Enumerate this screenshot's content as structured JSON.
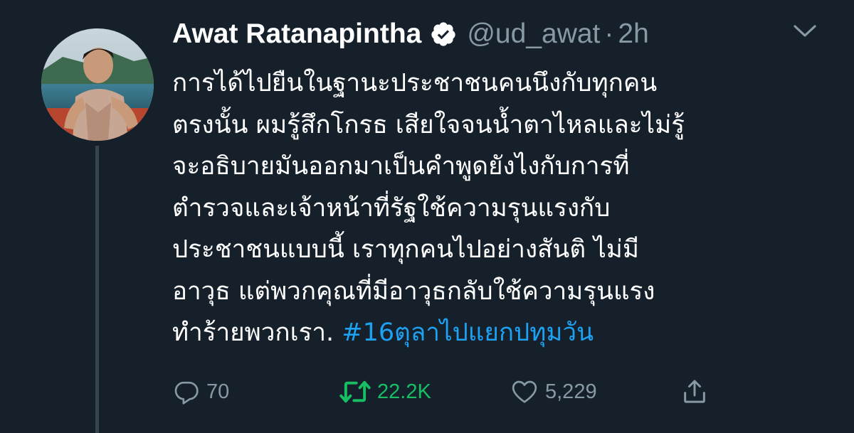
{
  "tweet": {
    "author": {
      "display_name": "Awat Ratanapintha",
      "verified_icon": "verified-badge-icon",
      "handle": "@ud_awat",
      "separator": "·",
      "time": "2h"
    },
    "menu_icon": "chevron-down-icon",
    "body_lines": [
      "การได้ไปยืนในฐานะประชาชนคนนึงกับทุกคน",
      "ตรงนั้น ผมรู้สึกโกรธ เสียใจจนน้ำตาไหลและไม่รู้",
      "จะอธิบายมันออกมาเป็นคำพูดยังไงกับการที่",
      "ตำรวจและเจ้าหน้าที่รัฐใช้ความรุนแรงกับ",
      "ประชาชนแบบนี้ เราทุกคนไปอย่างสันติ ไม่มี",
      "อาวุธ แต่พวกคุณที่มีอาวุธกลับใช้ความรุนแรง",
      "ทำร้ายพวกเรา. "
    ],
    "hashtag": "#16ตุลาไปแยกปทุมวัน",
    "actions": {
      "reply": {
        "icon": "reply-icon",
        "count": "70"
      },
      "retweet": {
        "icon": "retweet-icon",
        "count": "22.2K",
        "active_color": "#17bf63"
      },
      "like": {
        "icon": "heart-icon",
        "count": "5,229"
      },
      "share": {
        "icon": "share-icon"
      }
    }
  },
  "colors": {
    "background": "#15202b",
    "text": "#ffffff",
    "secondary": "#8899a6",
    "link": "#1da1f2",
    "thread_line": "#38444d"
  }
}
